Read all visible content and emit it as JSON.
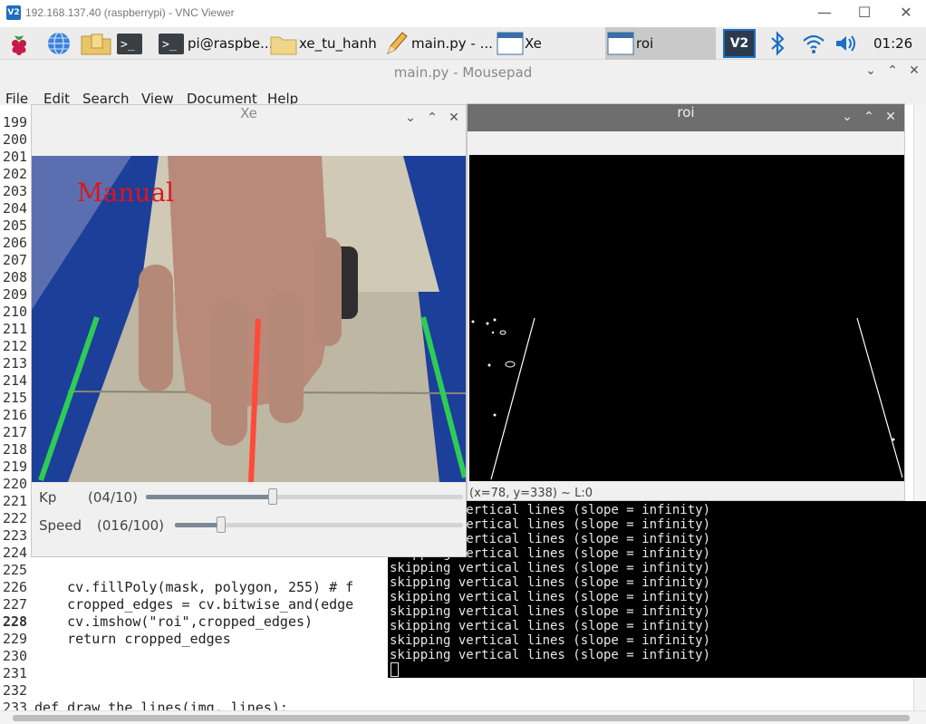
{
  "vnc": {
    "logo": "V2",
    "title": "192.168.137.40 (raspberrypi) - VNC Viewer",
    "minimize": "—",
    "maximize": "☐",
    "close": "✕"
  },
  "taskbar": {
    "terminal_label": "pi@raspbe...",
    "folder_label": "xe_tu_hanh",
    "editor_label": "main.py - ...",
    "xe_label": "Xe",
    "roi_label": "roi",
    "clock": "01:26",
    "vnc_icon": "V2"
  },
  "mousepad": {
    "title": "main.py - Mousepad",
    "menu": [
      "File",
      "Edit",
      "Search",
      "View",
      "Document",
      "Help"
    ],
    "line_numbers": [
      "199",
      "200",
      "201",
      "202",
      "203",
      "204",
      "205",
      "206",
      "207",
      "208",
      "209",
      "210",
      "211",
      "212",
      "213",
      "214",
      "215",
      "216",
      "217",
      "218",
      "219",
      "220",
      "221",
      "222",
      "223",
      "224",
      "225",
      "226",
      "227",
      "228",
      "229",
      "230",
      "231",
      "232",
      "233"
    ],
    "current_line": "228",
    "code": {
      "l226": "    cv.fillPoly(mask, polygon, 255) # f",
      "l227": "    cropped_edges = cv.bitwise_and(edge",
      "l228": "    cv.imshow(\"roi\",cropped_edges)",
      "l229": "    return cropped_edges",
      "l233": "def draw_the_lines(img, lines):"
    }
  },
  "terminal": {
    "lines": [
      "skipping vertical lines (slope = infinity)",
      "skipping vertical lines (slope = infinity)",
      "skipping vertical lines (slope = infinity)",
      "skipping vertical lines (slope = infinity)",
      "skipping vertical lines (slope = infinity)",
      "skipping vertical lines (slope = infinity)",
      "skipping vertical lines (slope = infinity)",
      "skipping vertical lines (slope = infinity)",
      "skipping vertical lines (slope = infinity)",
      "skipping vertical lines (slope = infinity)",
      "skipping vertical lines (slope = infinity)"
    ]
  },
  "xe": {
    "title": "Xe",
    "overlay_text": "Manual",
    "kp_label": "Kp",
    "kp_value": "(04/10)",
    "kp_fraction": 0.4,
    "speed_label": "Speed",
    "speed_value": "(016/100)",
    "speed_fraction": 0.16
  },
  "roi": {
    "title": "roi",
    "status": "(x=78, y=338) ~ L:0"
  },
  "window_buttons": {
    "menu": "⌄",
    "maximize": "⌃",
    "close": "✕"
  },
  "colors": {
    "accent": "#1e6fc0",
    "lane_green": "#2ecc55",
    "center_red": "#ff4a3a",
    "overlay_red": "#e0141e"
  }
}
